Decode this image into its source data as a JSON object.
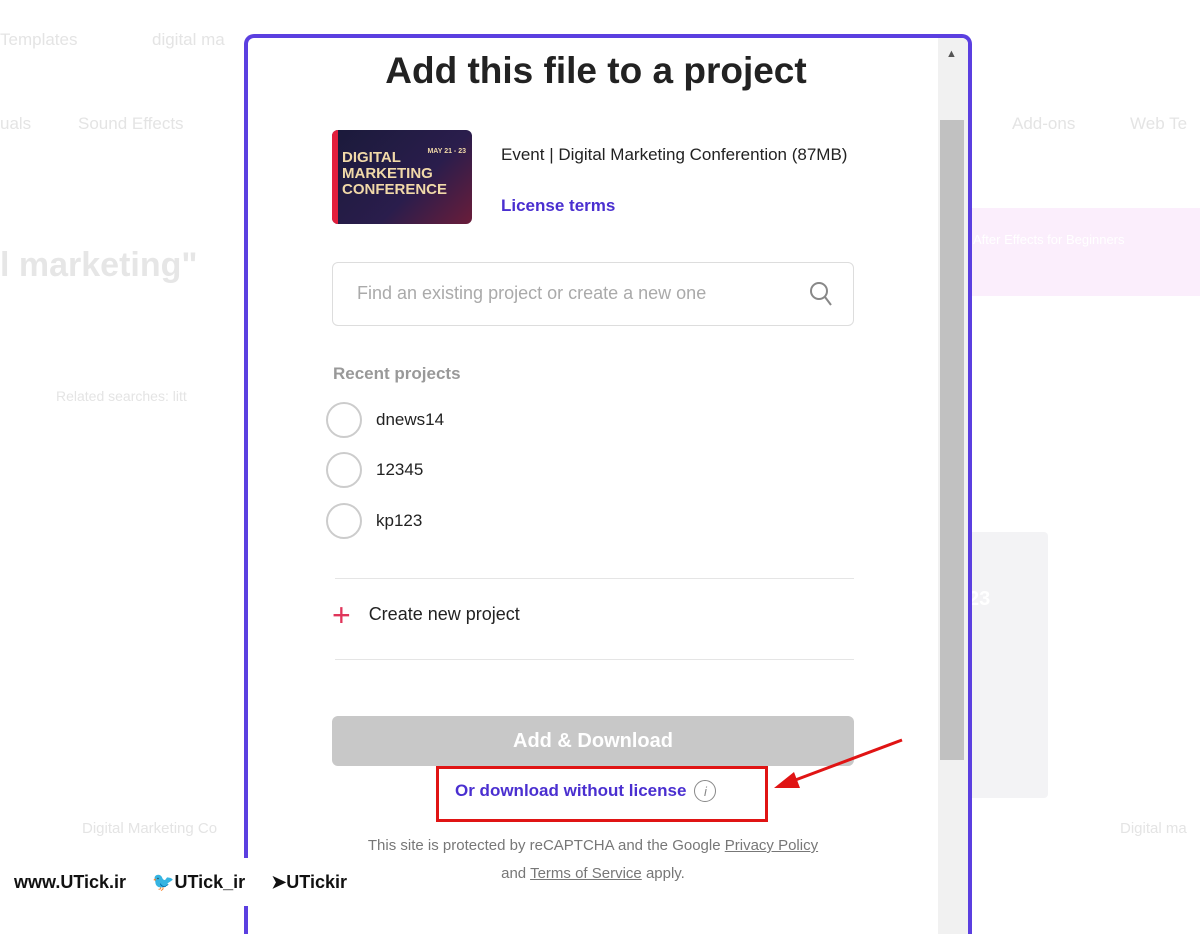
{
  "background": {
    "nav1": [
      "Templates",
      "digital ma"
    ],
    "nav2": [
      "uals",
      "Sound Effects",
      "Add-ons",
      "Web Te"
    ],
    "heading": "l marketing\"",
    "related": "Related searches: litt",
    "card_title": "Digital Marketing Co",
    "card_title_right": "Digital ma",
    "card_number": "23",
    "promo": "After Effects for Beginners"
  },
  "modal": {
    "title": "Add this file to a project",
    "thumbnail": {
      "text": "DIGITAL MARKETING CONFERENCE",
      "date": "MAY 21 - 23"
    },
    "file_title": "Event | Digital Marketing Conferention (87MB)",
    "license_terms": "License terms",
    "search_placeholder": "Find an existing project or create a new one",
    "recent_label": "Recent projects",
    "projects": [
      "dnews14",
      "12345",
      "kp123"
    ],
    "create_label": "Create new project",
    "add_download": "Add & Download",
    "download_without_license": "Or download without license",
    "legal": {
      "pre": "This site is protected by reCAPTCHA and the Google",
      "privacy": "Privacy Policy",
      "and": "and",
      "terms": "Terms of Service",
      "post": "apply."
    }
  },
  "watermark": {
    "site": "www.UTick.ir",
    "twitter": "UTick_ir",
    "telegram": "UTickir"
  },
  "colors": {
    "accent": "#5b3fe0",
    "highlight": "#e01414",
    "plus": "#e0355a"
  }
}
